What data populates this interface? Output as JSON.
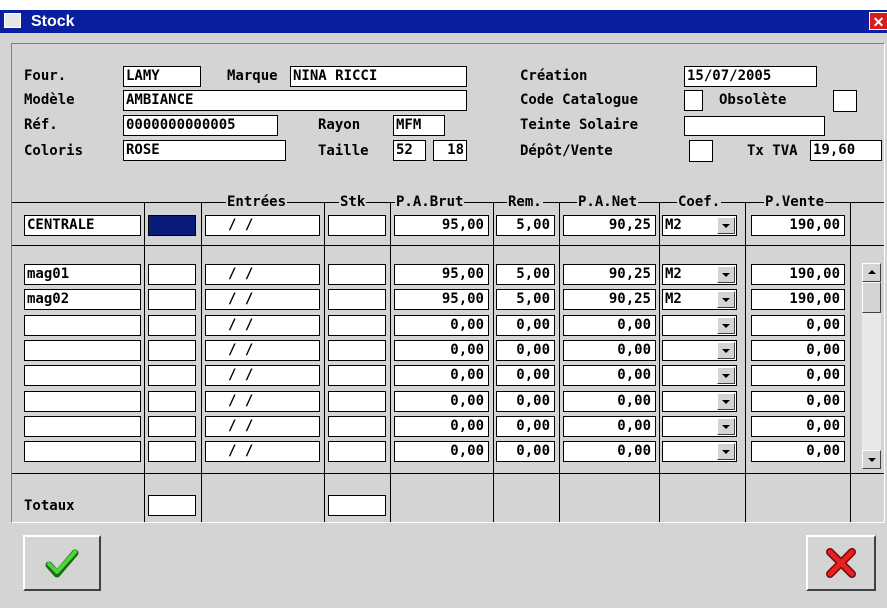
{
  "window": {
    "title": "Stock",
    "close_icon": "close-icon"
  },
  "header": {
    "fournisseur_label": "Four.",
    "fournisseur_value": "LAMY",
    "marque_label": "Marque",
    "marque_value": "NINA RICCI",
    "modele_label": "Modèle",
    "modele_value": "AMBIANCE",
    "ref_label": "Réf.",
    "ref_value": "0000000000005",
    "rayon_label": "Rayon",
    "rayon_value": "MFM",
    "coloris_label": "Coloris",
    "coloris_value": "ROSE",
    "taille_label": "Taille",
    "taille_value1": "52",
    "taille_value2": "18",
    "creation_label": "Création",
    "creation_value": "15/07/2005",
    "code_catalogue_label": "Code Catalogue",
    "obsolete_label": "Obsolète",
    "teinte_solaire_label": "Teinte Solaire",
    "teinte_solaire_value": "",
    "depot_vente_label": "Dépôt/Vente",
    "tva_label": "Tx TVA",
    "tva_value": "19,60"
  },
  "columns": {
    "entrees": "Entrées",
    "stk": "Stk",
    "pa_brut": "P.A.Brut",
    "rem": "Rem.",
    "pa_net": "P.A.Net",
    "coef": "Coef.",
    "p_vente": "P.Vente"
  },
  "centrale": {
    "name": "CENTRALE",
    "date": "/  /",
    "pa_brut": "95,00",
    "rem": "5,00",
    "pa_net": "90,25",
    "coef": "M2",
    "p_vente": "190,00"
  },
  "rows": [
    {
      "name": "mag01",
      "date": "/  /",
      "pa_brut": "95,00",
      "rem": "5,00",
      "pa_net": "90,25",
      "coef": "M2",
      "p_vente": "190,00"
    },
    {
      "name": "mag02",
      "date": "/  /",
      "pa_brut": "95,00",
      "rem": "5,00",
      "pa_net": "90,25",
      "coef": "M2",
      "p_vente": "190,00"
    },
    {
      "name": "",
      "date": "/  /",
      "pa_brut": "0,00",
      "rem": "0,00",
      "pa_net": "0,00",
      "coef": "",
      "p_vente": "0,00"
    },
    {
      "name": "",
      "date": "/  /",
      "pa_brut": "0,00",
      "rem": "0,00",
      "pa_net": "0,00",
      "coef": "",
      "p_vente": "0,00"
    },
    {
      "name": "",
      "date": "/  /",
      "pa_brut": "0,00",
      "rem": "0,00",
      "pa_net": "0,00",
      "coef": "",
      "p_vente": "0,00"
    },
    {
      "name": "",
      "date": "/  /",
      "pa_brut": "0,00",
      "rem": "0,00",
      "pa_net": "0,00",
      "coef": "",
      "p_vente": "0,00"
    },
    {
      "name": "",
      "date": "/  /",
      "pa_brut": "0,00",
      "rem": "0,00",
      "pa_net": "0,00",
      "coef": "",
      "p_vente": "0,00"
    },
    {
      "name": "",
      "date": "/  /",
      "pa_brut": "0,00",
      "rem": "0,00",
      "pa_net": "0,00",
      "coef": "",
      "p_vente": "0,00"
    }
  ],
  "totaux_label": "Totaux",
  "buttons": {
    "ok_icon": "checkmark-icon",
    "cancel_icon": "cross-icon"
  },
  "colors": {
    "title_bar": "#0a1fa0",
    "ok_check": "#38b82b",
    "cancel_cross": "#e02020",
    "focus_cell": "#0a1c7a"
  }
}
